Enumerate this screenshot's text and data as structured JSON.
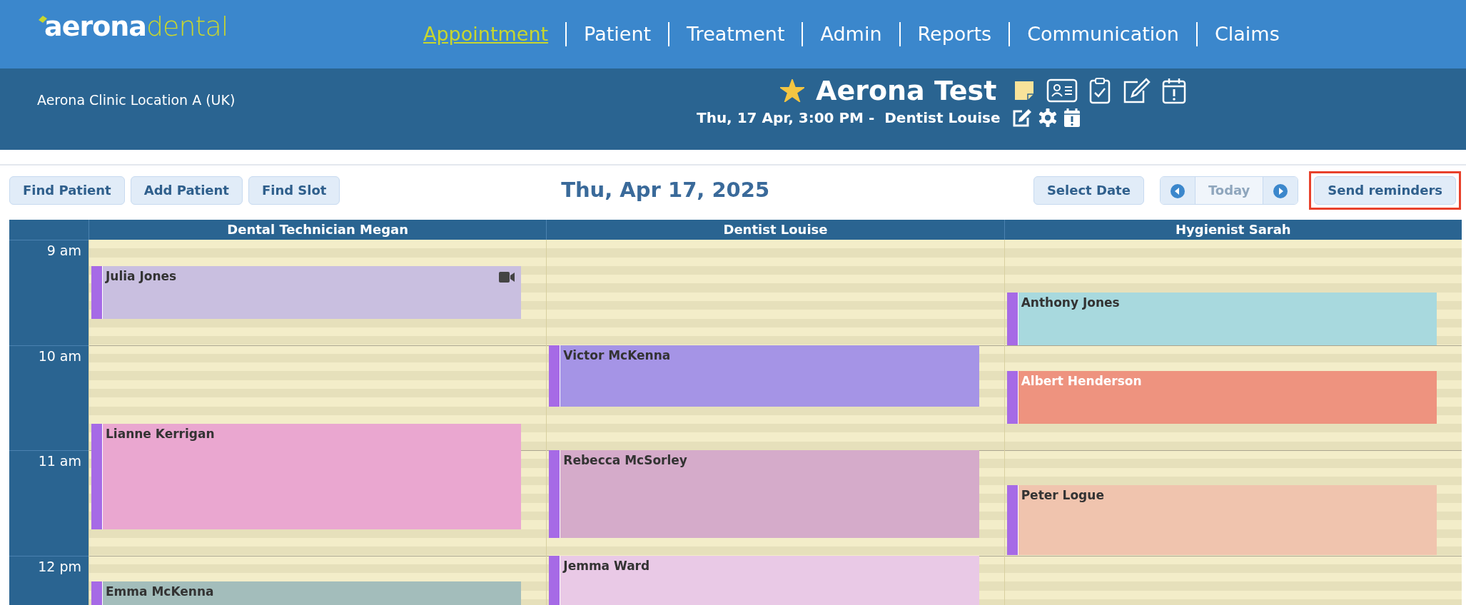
{
  "logo": [
    "aerona",
    "dental"
  ],
  "nav": [
    {
      "label": "Appointment",
      "selected": true
    },
    {
      "label": "Patient",
      "selected": false
    },
    {
      "label": "Treatment",
      "selected": false
    },
    {
      "label": "Admin",
      "selected": false
    },
    {
      "label": "Reports",
      "selected": false
    },
    {
      "label": "Communication",
      "selected": false
    },
    {
      "label": "Claims",
      "selected": false
    }
  ],
  "location": "Aerona Clinic Location A (UK)",
  "patient": {
    "name": "Aerona Test",
    "starred": true,
    "appointment": "Thu, 17 Apr, 3:00 PM -  Dentist Louise"
  },
  "toolbar": {
    "left_buttons": [
      "Find Patient",
      "Add Patient",
      "Find Slot"
    ],
    "date": "Thu, Apr 17, 2025",
    "select_date": "Select Date",
    "today": {
      "label": "Today",
      "disabled": true
    },
    "send_reminders": {
      "label": "Send reminders",
      "highlighted": true
    }
  },
  "calendar": {
    "times": [
      "9 am",
      "10 am",
      "11 am",
      "12 pm"
    ],
    "columns": [
      {
        "title": "Dental Technician Megan",
        "events": [
          {
            "name": "Julia Jones",
            "color": "#c9bfe0",
            "video": true
          },
          {
            "name": "Lianne Kerrigan",
            "color": "#eaa7d0",
            "video": false
          },
          {
            "name": "Emma McKenna",
            "color": "#a3bdbb",
            "video": false
          }
        ]
      },
      {
        "title": "Dentist Louise",
        "events": [
          {
            "name": "Victor McKenna",
            "color": "#a594e6",
            "video": false
          },
          {
            "name": "Rebecca McSorley",
            "color": "#d5abca",
            "video": false
          },
          {
            "name": "Jemma Ward",
            "color": "#e9c9e6",
            "video": false
          }
        ]
      },
      {
        "title": "Hygienist Sarah",
        "events": [
          {
            "name": "Anthony Jones",
            "color": "#a8d9de",
            "video": false
          },
          {
            "name": "Albert Henderson",
            "color": "#ee937f",
            "video": false
          },
          {
            "name": "Peter Logue",
            "color": "#f0c4ae",
            "video": false
          }
        ]
      }
    ]
  }
}
